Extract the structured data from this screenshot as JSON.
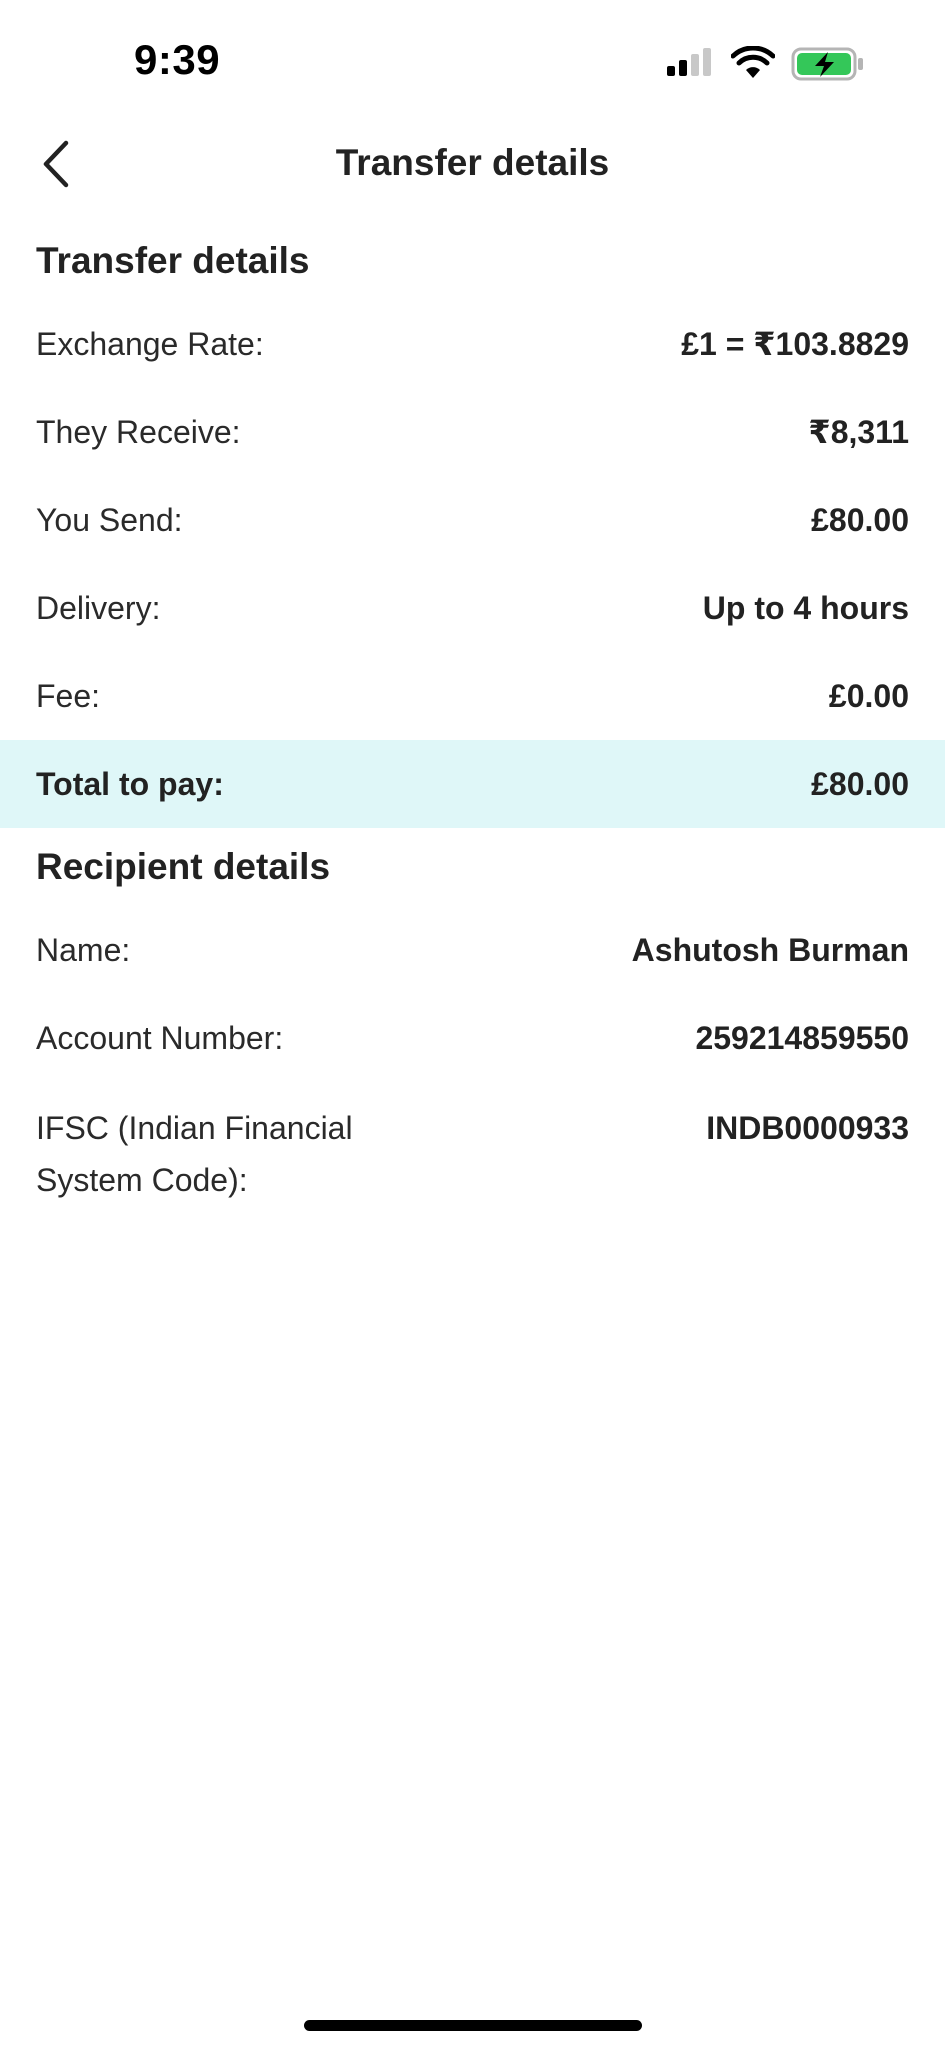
{
  "status_bar": {
    "time": "9:39",
    "icons": [
      "signal-icon",
      "wifi-icon",
      "battery-charging-icon"
    ],
    "battery_color": "#34c759"
  },
  "nav": {
    "back_icon": "chevron-left-icon",
    "title": "Transfer details"
  },
  "transfer_section": {
    "title": "Transfer details",
    "rows": [
      {
        "label": "Exchange Rate:",
        "value": "£1 = ₹103.8829"
      },
      {
        "label": "They Receive:",
        "value": "₹8,311"
      },
      {
        "label": "You Send:",
        "value": "£80.00"
      },
      {
        "label": "Delivery:",
        "value": "Up to 4 hours"
      },
      {
        "label": "Fee:",
        "value": "£0.00"
      }
    ],
    "total": {
      "label": "Total to pay:",
      "value": "£80.00"
    }
  },
  "recipient_section": {
    "title": "Recipient details",
    "rows": [
      {
        "label": "Name:",
        "value": "Ashutosh Burman"
      },
      {
        "label": "Account Number:",
        "value": "259214859550"
      },
      {
        "label": "IFSC (Indian Financial System Code):",
        "value": "INDB0000933"
      }
    ]
  },
  "colors": {
    "total_highlight": "#dff7f8",
    "text": "#222222"
  }
}
